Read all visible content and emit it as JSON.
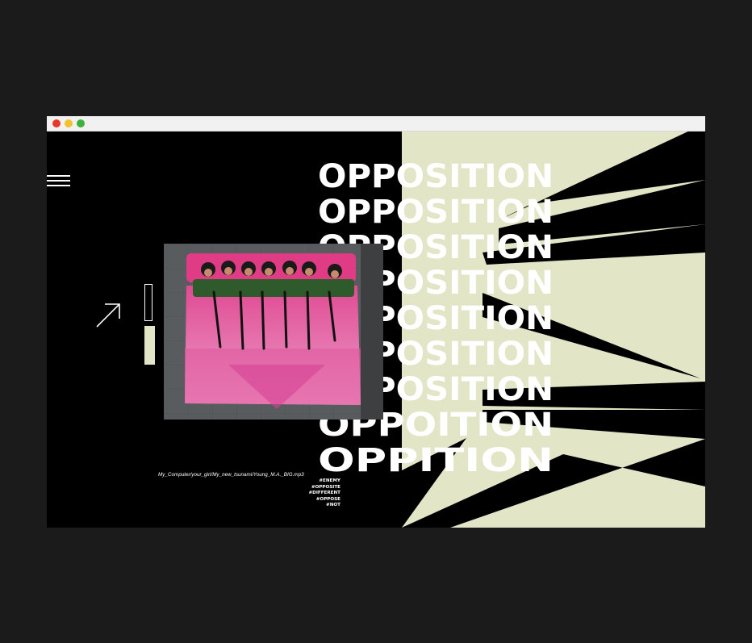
{
  "window": {
    "controls": [
      "close",
      "minimize",
      "maximize"
    ]
  },
  "menu": {
    "icon": "hamburger-menu-icon"
  },
  "headline": {
    "lines": [
      "OPPOSITION",
      "OPPOSITION",
      "OPPOSITION",
      "OPPOSITION",
      "OPPOSITION",
      "OPPOSITION",
      "OPPOSITION",
      "OPPOITION",
      "OPPITION"
    ]
  },
  "photo": {
    "description_icon": "photo-children-with-rifles-on-pink-bedding"
  },
  "caption": {
    "path": "My_Computer/your_girl/My_new_tsunami/Young_M.A._BIG.mp3"
  },
  "tags": [
    "#ENEMY",
    "#OPPOSITE",
    "#DIFFERENT",
    "#OPPOSE",
    "#NOT"
  ],
  "colors": {
    "background": "#000000",
    "accent": "#e2e6c6",
    "text": "#ffffff",
    "outer": "#1b1b1b"
  }
}
